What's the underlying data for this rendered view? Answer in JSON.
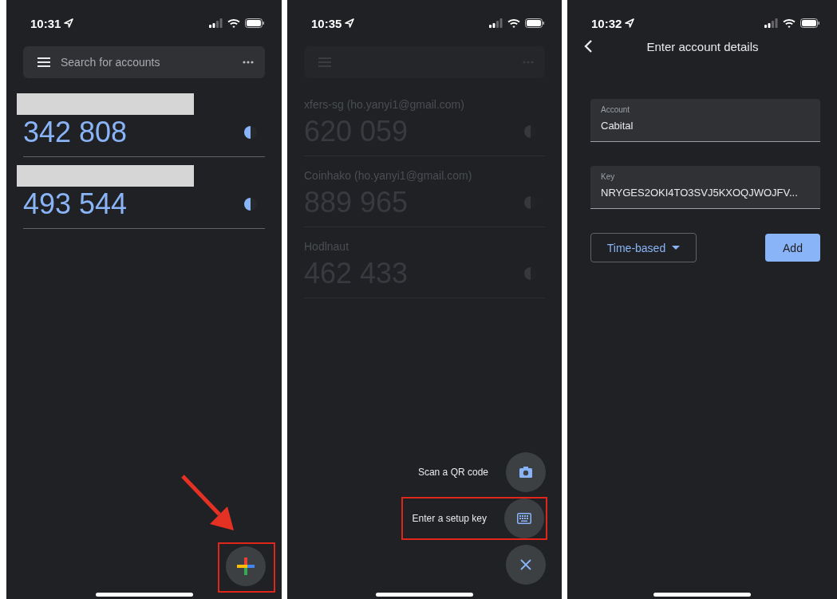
{
  "screens": [
    {
      "kind": "list",
      "time": "10:31",
      "search": {
        "placeholder": "Search for accounts"
      },
      "accounts": [
        {
          "redacted": true,
          "code": "342 808",
          "level": 0.5
        },
        {
          "redacted": true,
          "code": "493 544",
          "level": 0.5
        }
      ],
      "fab_highlighted": true,
      "arrow": true
    },
    {
      "kind": "menu",
      "time": "10:35",
      "accounts": [
        {
          "name": "xfers-sg (ho.yanyi1@gmail.com)",
          "code": "620 059",
          "level": 0.5
        },
        {
          "name": "Coinhako (ho.yanyi1@gmail.com)",
          "code": "889 965",
          "level": 0.5
        },
        {
          "name": "Hodlnaut",
          "code": "462 433",
          "level": 0.5
        }
      ],
      "menu_items": [
        {
          "label": "Scan a QR code",
          "kind": "camera",
          "highlighted": false
        },
        {
          "label": "Enter a setup key",
          "kind": "keyboard",
          "highlighted": true
        }
      ]
    },
    {
      "kind": "form",
      "time": "10:32",
      "title": "Enter account details",
      "fields": [
        {
          "label": "Account",
          "value": "Cabital"
        },
        {
          "label": "Key",
          "value": "NRYGES2OKI4TO3SVJ5KXOQJWOJFV..."
        }
      ],
      "type_select": "Time-based",
      "add_button": "Add"
    }
  ]
}
